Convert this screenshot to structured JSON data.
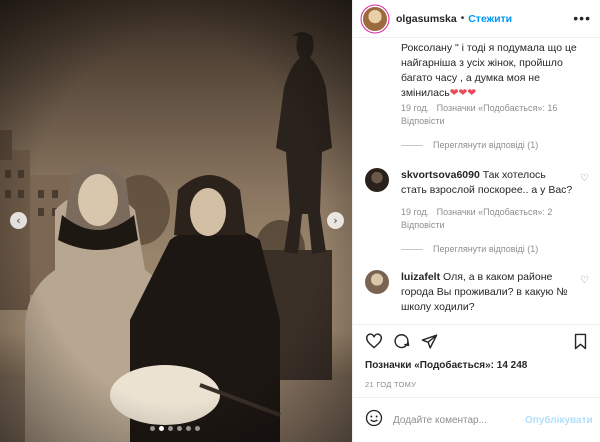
{
  "post": {
    "username": "olgasumska",
    "separator": "•",
    "follow_label": "Стежити",
    "more_icon": "more-horizontal-icon"
  },
  "comments": [
    {
      "text": "Роксолану \" і тоді я подумала що це найгарніша з усіх жінок, пройшло багато часу , а думка моя не змінилась",
      "hearts": "❤❤❤",
      "age": "19 год.",
      "likes": "Позначки «Подобається»: 16",
      "reply": "Відповісти",
      "view_replies": "Переглянути відповіді (1)"
    },
    {
      "username": "skvortsova6090",
      "text": "Так хотелось стать взрослой поскорее.. а у Вас?",
      "age": "19 год.",
      "likes": "Позначки «Подобається»: 2",
      "reply": "Відповісти",
      "view_replies": "Переглянути відповіді (1)"
    },
    {
      "username": "luizafelt",
      "text": "Оля, а в каком районе города Вы проживали? в какую № школу ходили?"
    }
  ],
  "footer": {
    "likes_label": "Позначки «Подобається»: 14 248",
    "time_ago": "21 ГОД ТОМУ",
    "comment_placeholder": "Додайте коментар...",
    "publish_label": "Опублікувати"
  },
  "carousel": {
    "slides": 6,
    "active": 2
  },
  "colors": {
    "link_blue": "#0095f6",
    "heart_red": "#ed4956",
    "muted": "#8e8e8e",
    "publish_disabled": "#b2dffc"
  }
}
